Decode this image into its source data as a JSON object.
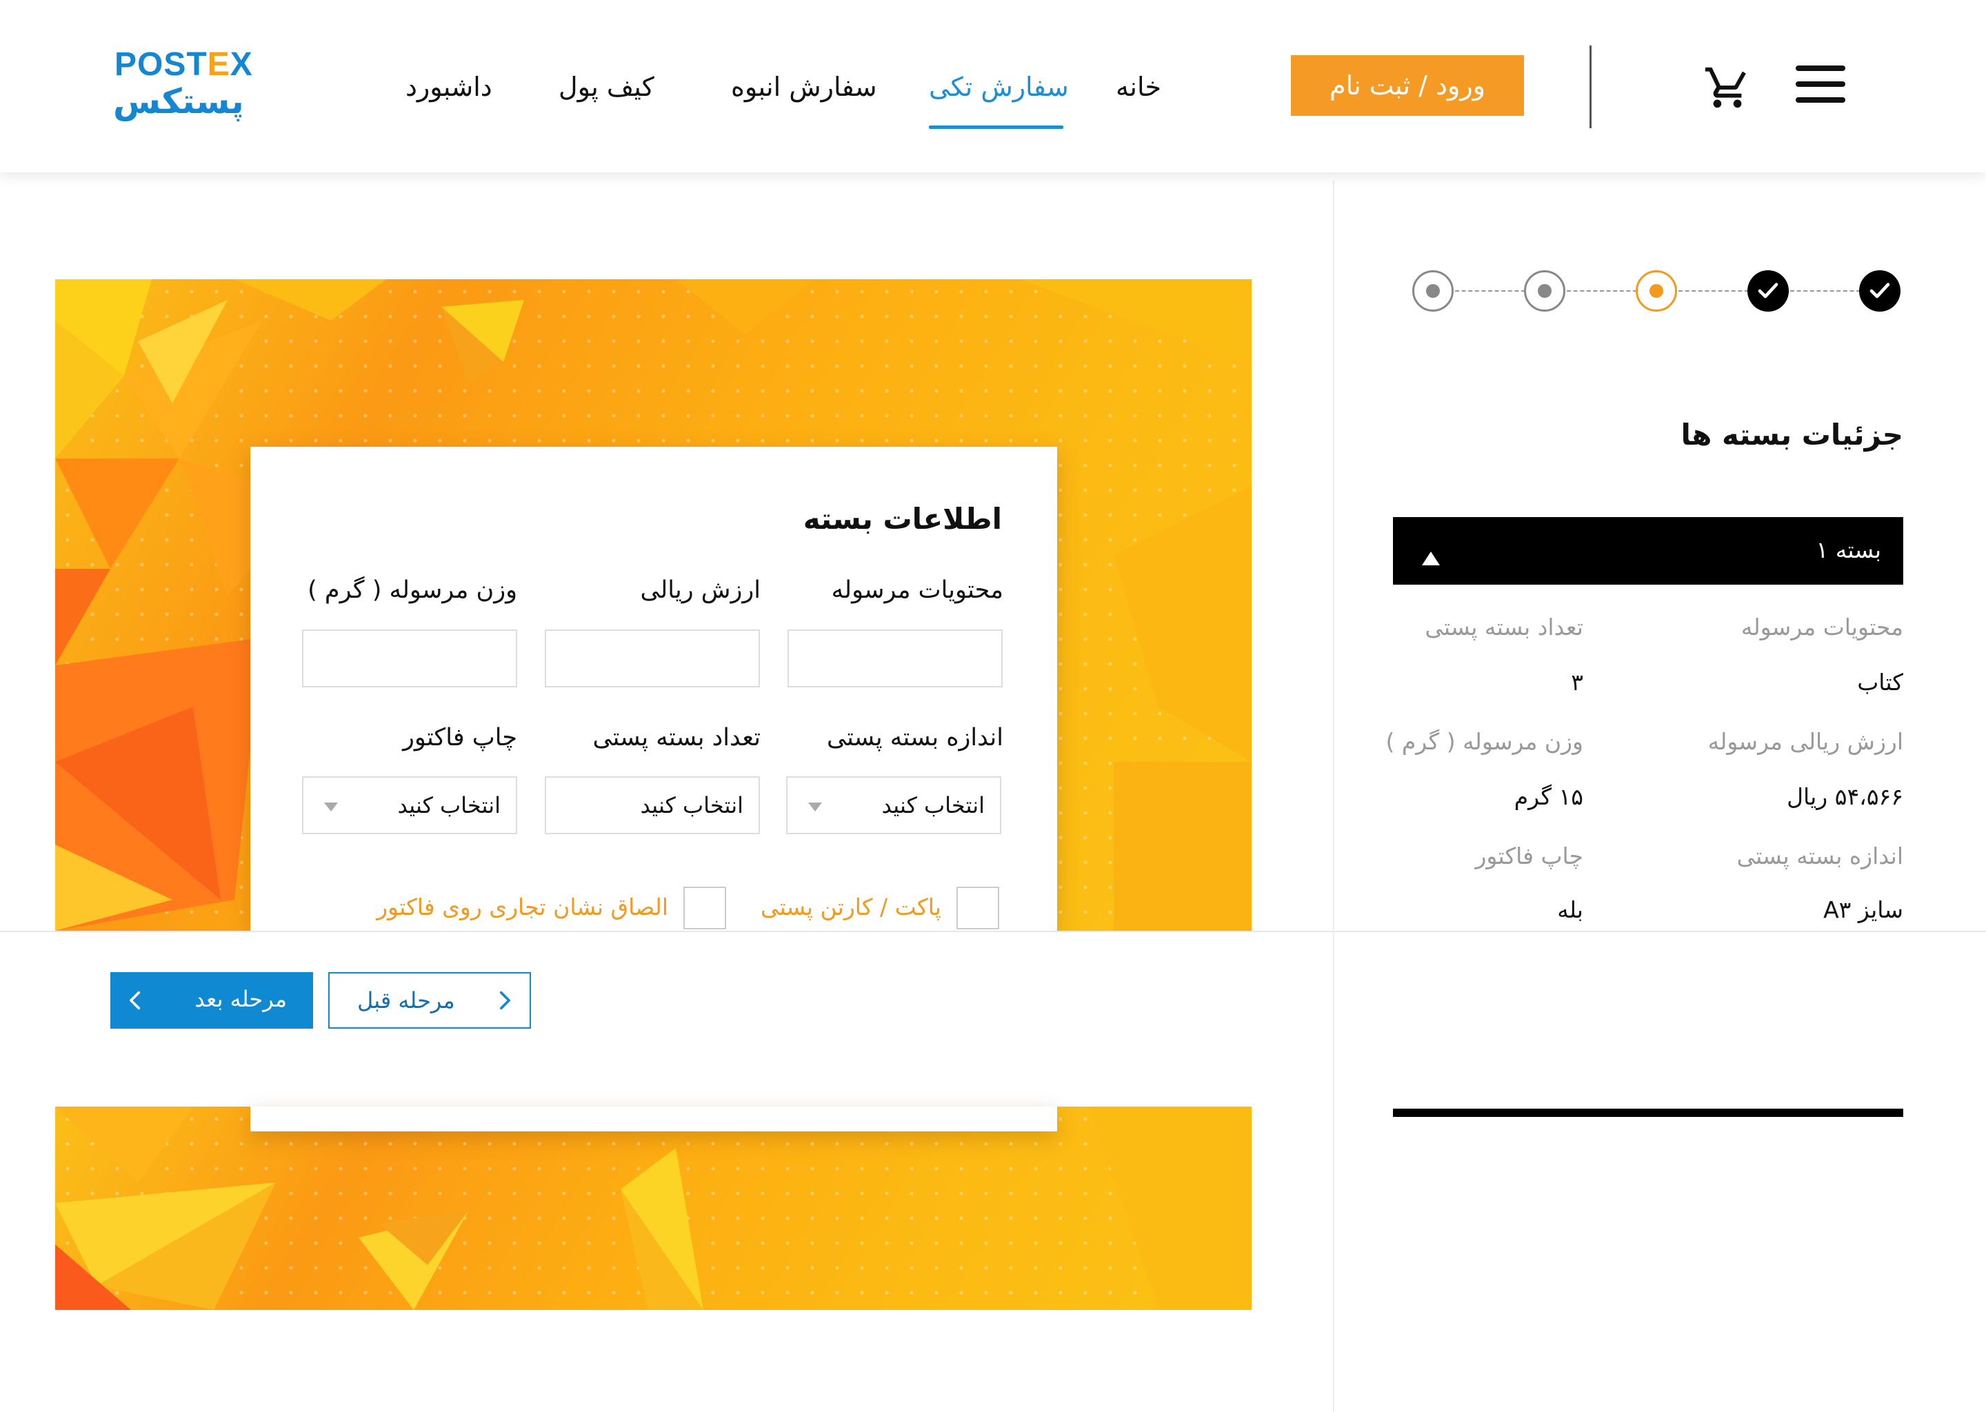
{
  "header": {
    "logo_latin": "POSTEX",
    "logo_fa": "پستکس",
    "nav": [
      {
        "label": "داشبورد"
      },
      {
        "label": "کیف پول"
      },
      {
        "label": "سفارش انبوه"
      },
      {
        "label": "سفارش تکی",
        "active": true
      },
      {
        "label": "خانه"
      }
    ],
    "login_label": "ورود / ثبت نام",
    "cart_icon": "cart-icon",
    "menu_icon": "menu-icon"
  },
  "stepper": {
    "states": [
      "todo",
      "todo",
      "current",
      "done",
      "done"
    ],
    "colors": {
      "current": "#f39a1d",
      "done": "#000000",
      "todo": "#888888"
    }
  },
  "form": {
    "title": "اطلاعات بسته",
    "labels": {
      "contents": "محتویات مرسوله",
      "value": "ارزش ریالی",
      "weight": "وزن مرسوله ( گرم )",
      "size": "اندازه بسته پستی",
      "count": "تعداد بسته پستی",
      "invoice": "چاپ فاکتور"
    },
    "select_placeholder": "انتخاب کنید",
    "checkboxes": {
      "packet": "پاکت / کارتن پستی",
      "brand": "الصاق نشان تجاری روی فاکتور"
    }
  },
  "sidebar": {
    "title": "جزئیات بسته ها",
    "package_header": "بسته ۱",
    "details": {
      "contents_label": "محتویات مرسوله",
      "contents_value": "کتاب",
      "count_label": "تعداد بسته پستی",
      "count_value": "۳",
      "value_label": "ارزش ریالی مرسوله",
      "value_value": "۵۴،۵۶۶ ریال",
      "weight_label": "وزن مرسوله ( گرم )",
      "weight_value": "۱۵ گرم",
      "size_label": "اندازه بسته پستی",
      "size_value": "سایز A۳",
      "invoice_label": "چاپ فاکتور",
      "invoice_value": "بله"
    }
  },
  "footer": {
    "next_label": "مرحله بعد",
    "prev_label": "مرحله قبل"
  },
  "colors": {
    "accent_blue": "#1a8fd6",
    "accent_orange": "#f59a24"
  }
}
